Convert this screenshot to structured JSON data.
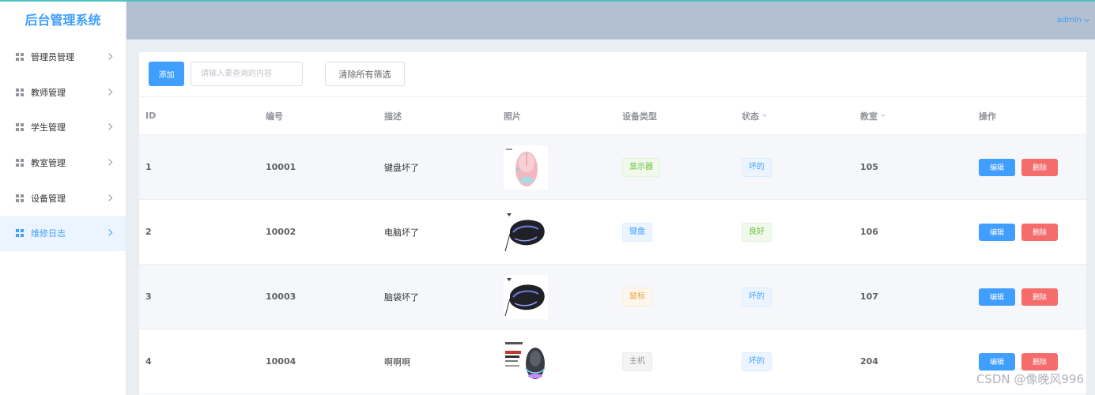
{
  "app": {
    "title": "后台管理系统"
  },
  "header": {
    "user": "admin"
  },
  "sidebar": {
    "items": [
      {
        "label": "管理员管理",
        "icon": "grid-icon",
        "active": false
      },
      {
        "label": "教师管理",
        "icon": "grid-icon",
        "active": false
      },
      {
        "label": "学生管理",
        "icon": "grid-icon",
        "active": false
      },
      {
        "label": "教室管理",
        "icon": "grid-icon",
        "active": false
      },
      {
        "label": "设备管理",
        "icon": "grid-icon",
        "active": false
      },
      {
        "label": "维修日志",
        "icon": "grid-icon",
        "active": true
      }
    ]
  },
  "toolbar": {
    "add_label": "添加",
    "search_placeholder": "请输入要查询的内容",
    "search_value": "",
    "clear_label": "清除所有筛选"
  },
  "table": {
    "columns": [
      "ID",
      "编号",
      "描述",
      "照片",
      "设备类型",
      "状态",
      "教室",
      "操作"
    ],
    "rows": [
      {
        "id": "1",
        "no": "10001",
        "desc": "键盘坏了",
        "photo": "pink-mouse-photo",
        "type": "显示器",
        "type_style": "success",
        "status": "坏的",
        "status_style": "primary",
        "room": "105",
        "edit": "编辑",
        "delete": "删除"
      },
      {
        "id": "2",
        "no": "10002",
        "desc": "电脑坏了",
        "photo": "black-mouse-photo",
        "type": "键盘",
        "type_style": "primary",
        "status": "良好",
        "status_style": "success",
        "room": "106",
        "edit": "编辑",
        "delete": "删除"
      },
      {
        "id": "3",
        "no": "10003",
        "desc": "脑袋坏了",
        "photo": "black-mouse-photo",
        "type": "鼠标",
        "type_style": "warning",
        "status": "坏的",
        "status_style": "primary",
        "room": "107",
        "edit": "编辑",
        "delete": "删除"
      },
      {
        "id": "4",
        "no": "10004",
        "desc": "啊啊啊",
        "photo": "boxed-mouse-photo",
        "type": "主机",
        "type_style": "info",
        "status": "坏的",
        "status_style": "primary",
        "room": "204",
        "edit": "编辑",
        "delete": "删除"
      }
    ]
  },
  "watermark": "CSDN @像晚风996",
  "colors": {
    "primary": "#409eff",
    "danger": "#f56c6c",
    "header": "#b3c0d1",
    "page_bg": "#e9eef3"
  }
}
